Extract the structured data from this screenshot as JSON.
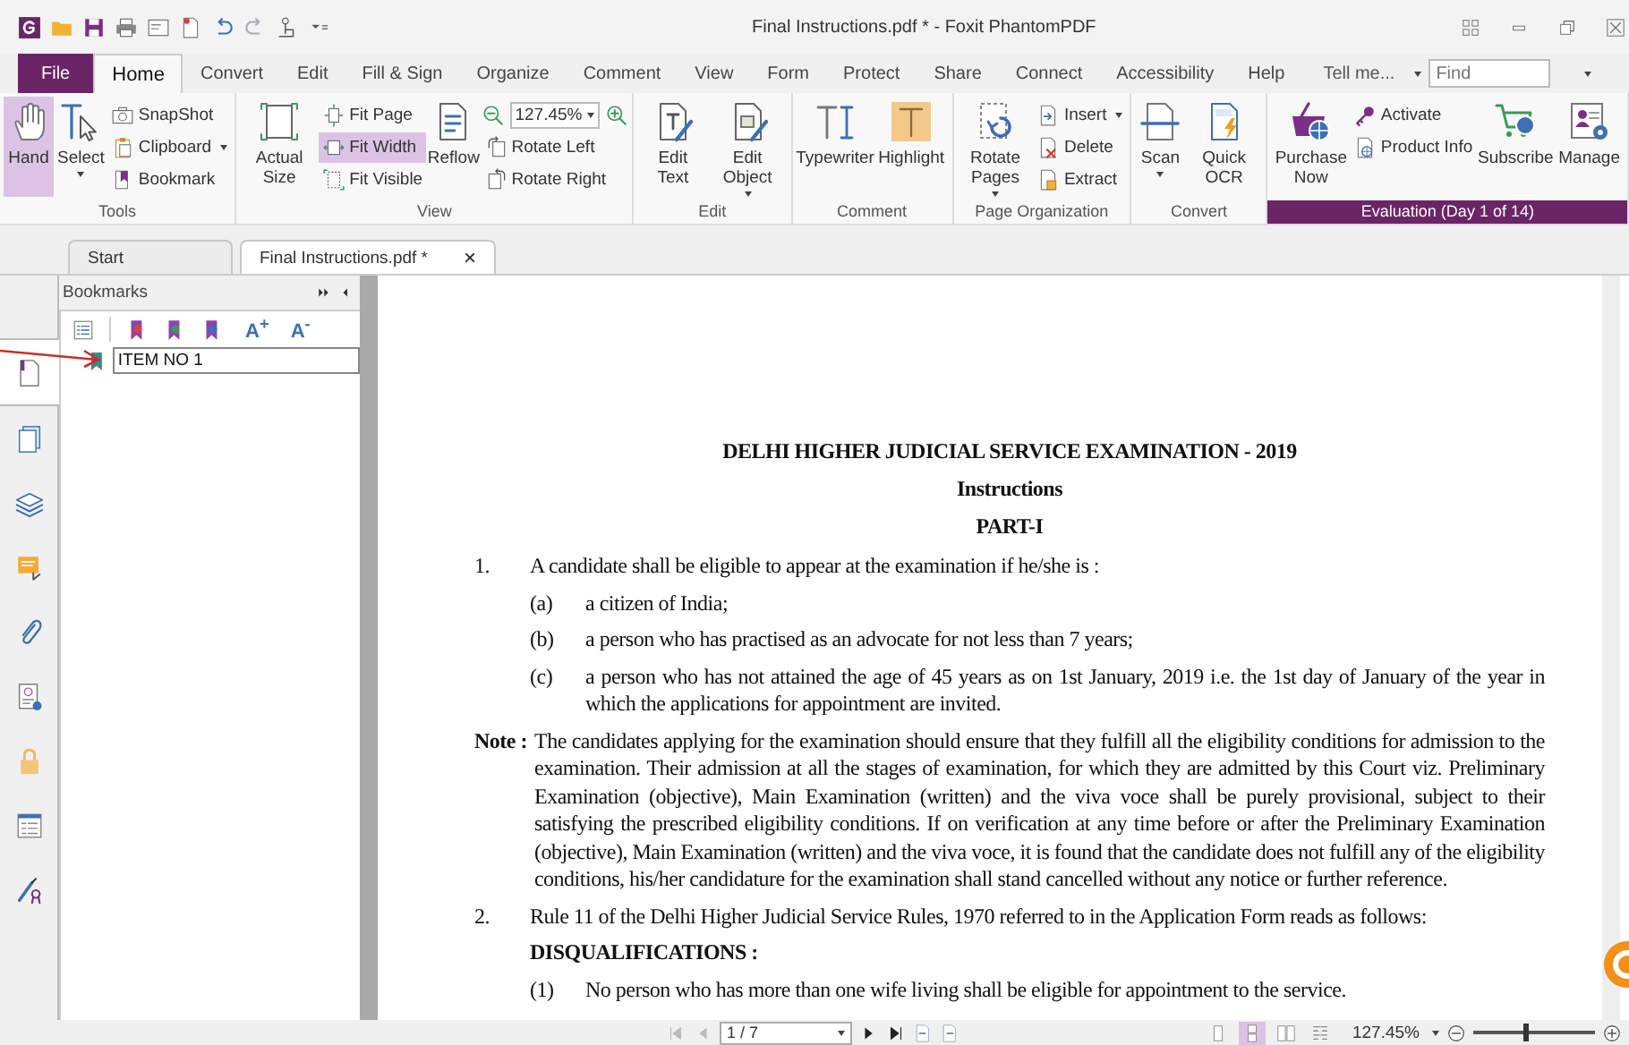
{
  "window": {
    "title": "Final Instructions.pdf * - Foxit PhantomPDF"
  },
  "menu_tabs": [
    {
      "label": "File",
      "kind": "file",
      "selected": false
    },
    {
      "label": "Home",
      "kind": "tab",
      "selected": true
    },
    {
      "label": "Convert",
      "kind": "tab",
      "selected": false
    },
    {
      "label": "Edit",
      "kind": "tab",
      "selected": false
    },
    {
      "label": "Fill & Sign",
      "kind": "tab",
      "selected": false
    },
    {
      "label": "Organize",
      "kind": "tab",
      "selected": false
    },
    {
      "label": "Comment",
      "kind": "tab",
      "selected": false
    },
    {
      "label": "View",
      "kind": "tab",
      "selected": false
    },
    {
      "label": "Form",
      "kind": "tab",
      "selected": false
    },
    {
      "label": "Protect",
      "kind": "tab",
      "selected": false
    },
    {
      "label": "Share",
      "kind": "tab",
      "selected": false
    },
    {
      "label": "Connect",
      "kind": "tab",
      "selected": false
    },
    {
      "label": "Accessibility",
      "kind": "tab",
      "selected": false
    },
    {
      "label": "Help",
      "kind": "tab",
      "selected": false
    }
  ],
  "tell_me": "Tell me...",
  "find": {
    "placeholder": "Find"
  },
  "ribbon_groups": [
    {
      "label": "Tools",
      "highlight": false,
      "columns": [
        {
          "kind": "large",
          "label": "Hand",
          "selected": true,
          "dropdown": false
        },
        {
          "kind": "large",
          "label": "Select",
          "selected": false,
          "dropdown": true
        },
        {
          "kind": "small",
          "items": [
            {
              "label": "SnapShot",
              "selected": false,
              "dropdown": false
            },
            {
              "label": "Clipboard",
              "selected": false,
              "dropdown": true
            },
            {
              "label": "Bookmark",
              "selected": false,
              "dropdown": false
            }
          ]
        }
      ]
    },
    {
      "label": "View",
      "highlight": false,
      "columns": [
        {
          "kind": "large",
          "label": "Actual Size",
          "selected": false,
          "dropdown": false
        },
        {
          "kind": "small",
          "items": [
            {
              "label": "Fit Page",
              "selected": false,
              "dropdown": false
            },
            {
              "label": "Fit Width",
              "selected": true,
              "dropdown": false
            },
            {
              "label": "Fit Visible",
              "selected": false,
              "dropdown": false
            }
          ]
        },
        {
          "kind": "large",
          "label": "Reflow",
          "selected": false,
          "dropdown": false
        },
        {
          "kind": "zoom",
          "value": "127.45%",
          "items": [
            {
              "label": "Rotate Left",
              "selected": false,
              "dropdown": false
            },
            {
              "label": "Rotate Right",
              "selected": false,
              "dropdown": false
            }
          ]
        }
      ]
    },
    {
      "label": "Edit",
      "highlight": false,
      "columns": [
        {
          "kind": "large",
          "label": "Edit Text",
          "selected": false,
          "dropdown": false
        },
        {
          "kind": "large",
          "label": "Edit Object",
          "selected": false,
          "dropdown": true
        }
      ]
    },
    {
      "label": "Comment",
      "highlight": false,
      "columns": [
        {
          "kind": "large",
          "label": "Typewriter",
          "selected": false,
          "dropdown": false
        },
        {
          "kind": "large",
          "label": "Highlight",
          "selected": false,
          "dropdown": false
        }
      ]
    },
    {
      "label": "Page Organization",
      "highlight": false,
      "columns": [
        {
          "kind": "large",
          "label": "Rotate Pages",
          "selected": false,
          "dropdown": true
        },
        {
          "kind": "small",
          "items": [
            {
              "label": "Insert",
              "selected": false,
              "dropdown": true
            },
            {
              "label": "Delete",
              "selected": false,
              "dropdown": false
            },
            {
              "label": "Extract",
              "selected": false,
              "dropdown": false
            }
          ]
        }
      ]
    },
    {
      "label": "Convert",
      "highlight": false,
      "columns": [
        {
          "kind": "large",
          "label": "Scan",
          "selected": false,
          "dropdown": true
        },
        {
          "kind": "large",
          "label": "Quick OCR",
          "selected": false,
          "dropdown": false
        }
      ]
    },
    {
      "label": "Evaluation (Day 1 of 14)",
      "highlight": true,
      "columns": [
        {
          "kind": "large",
          "label": "Purchase Now",
          "selected": false,
          "dropdown": false
        },
        {
          "kind": "small",
          "items": [
            {
              "label": "Activate",
              "selected": false,
              "dropdown": false
            },
            {
              "label": "Product Info",
              "selected": false,
              "dropdown": false
            }
          ]
        },
        {
          "kind": "large",
          "label": "Subscribe",
          "selected": false,
          "dropdown": false
        },
        {
          "kind": "large",
          "label": "Manage",
          "selected": false,
          "dropdown": false
        }
      ]
    }
  ],
  "doc_tabs": [
    {
      "label": "Start",
      "selected": false
    },
    {
      "label": "Final Instructions.pdf *",
      "selected": true,
      "close": "×"
    }
  ],
  "side_tabs": [
    {
      "selected": true
    },
    {
      "selected": false
    },
    {
      "selected": false
    },
    {
      "selected": false
    },
    {
      "selected": false
    },
    {
      "selected": false
    },
    {
      "selected": false
    },
    {
      "selected": false
    },
    {
      "selected": false
    }
  ],
  "bookmarks": {
    "title": "Bookmarks",
    "font_buttons": [
      "A$^{+}$",
      "A$^{-}$"
    ],
    "items": [
      {
        "value": "ITEM NO 1",
        "editing": true
      }
    ]
  },
  "document": {
    "title": "DELHI HIGHER JUDICIAL SERVICE EXAMINATION - 2019",
    "subtitle": "Instructions",
    "part": "PART-I",
    "items": [
      {
        "kind": "numbered",
        "number": "1.",
        "text": "A candidate shall be eligible to appear at the examination if he/she is :",
        "subitems": [
          {
            "label": "(a)",
            "text": "a citizen of India;"
          },
          {
            "label": "(b)",
            "text": "a person who has practised as an advocate for not less than 7 years;"
          },
          {
            "label": "(c)",
            "text": "a person who has not attained the age of 45 years as on 1st January, 2019 i.e. the 1st day of January of the year in which the applications for appointment are invited."
          }
        ]
      },
      {
        "kind": "note",
        "number": "Note :",
        "text": "The candidates applying for the examination should ensure that they fulfill all the eligibility conditions for admission to the examination. Their admission at all the stages of examination, for which they are admitted by this Court viz. Preliminary Examination (objective), Main Examination (written) and the viva voce shall be purely provisional, subject to their satisfying the prescribed eligibility conditions. If on verification at any time before or after the Preliminary Examination (objective), Main Examination (written) and the viva voce, it is found that the candidate does not fulfill any of the eligibility conditions, his/her candidature for the examination shall stand cancelled without any notice or further reference."
      },
      {
        "kind": "numbered",
        "number": "2.",
        "text": "Rule 11 of the Delhi Higher Judicial Service Rules, 1970 referred to in the Application Form reads as follows:",
        "heading": "DISQUALIFICATIONS :",
        "subitems": [
          {
            "label": "(1)",
            "text": "No person who has more than one wife living shall be eligible for appointment to the service."
          }
        ]
      }
    ]
  },
  "status_bar": {
    "page": "1 / 7",
    "zoom": "127.45%",
    "view_modes": [
      {
        "selected": false
      },
      {
        "selected": true
      },
      {
        "selected": false
      },
      {
        "selected": false
      }
    ],
    "zoom_slider": {
      "level": 0.42
    }
  }
}
